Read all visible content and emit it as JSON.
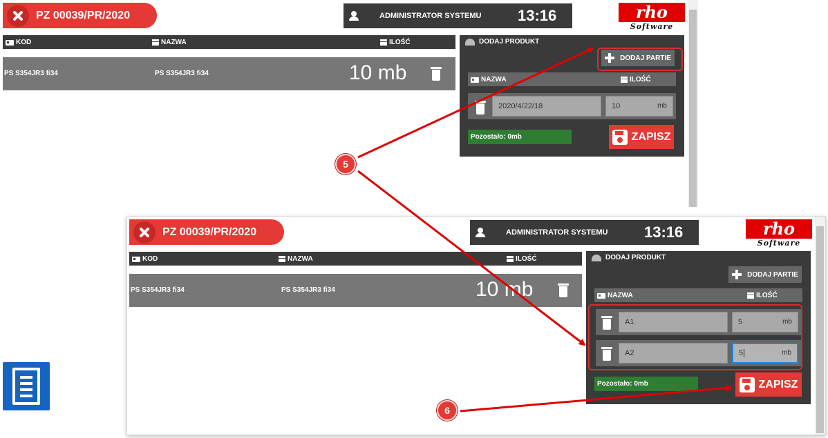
{
  "shots": [
    {
      "document_title": "PZ 00039/PR/2020",
      "user_name": "ADMINISTRATOR SYSTEMU",
      "clock": "13:16",
      "logo": {
        "main": "rho",
        "sub": "Software"
      },
      "table_headers": {
        "code": "KOD",
        "name": "NAZWA",
        "qty": "ILOŚĆ"
      },
      "product_row": {
        "code": "PS S354JR3 fi34",
        "name": "PS S354JR3 fi34",
        "qty": "10 mb"
      },
      "panel": {
        "title": "DODAJ PRODUKT",
        "add_batch_label": "DODAJ PARTIE",
        "sub_headers": {
          "name": "NAZWA",
          "qty": "ILOŚĆ"
        },
        "batches": [
          {
            "name": "2020/4/22/18",
            "qty": "10",
            "unit": "mb"
          }
        ],
        "remaining": "Pozostało: 0mb",
        "save_label": "ZAPISZ"
      }
    },
    {
      "document_title": "PZ 00039/PR/2020",
      "user_name": "ADMINISTRATOR SYSTEMU",
      "clock": "13:16",
      "logo": {
        "main": "rho",
        "sub": "Software"
      },
      "table_headers": {
        "code": "KOD",
        "name": "NAZWA",
        "qty": "ILOŚĆ"
      },
      "product_row": {
        "code": "PS S354JR3 fi34",
        "name": "PS S354JR3 fi34",
        "qty": "10 mb"
      },
      "panel": {
        "title": "DODAJ PRODUKT",
        "add_batch_label": "DODAJ PARTIE",
        "sub_headers": {
          "name": "NAZWA",
          "qty": "ILOŚĆ"
        },
        "batches": [
          {
            "name": "A1",
            "qty": "5",
            "unit": "mb"
          },
          {
            "name": "A2",
            "qty": "5",
            "unit": "mb"
          }
        ],
        "remaining": "Pozostało: 0mb",
        "save_label": "ZAPISZ"
      }
    }
  ],
  "callouts": [
    {
      "number": "5"
    },
    {
      "number": "6"
    }
  ],
  "icons": {
    "close": "x-circle-icon",
    "user": "user-icon",
    "card": "id-card-icon",
    "box": "archive-box-icon",
    "trash": "trash-icon",
    "warehouse": "warehouse-icon",
    "plus": "plus-icon",
    "save": "floppy-disk-icon",
    "receipt": "receipt-icon"
  },
  "colors": {
    "accent_red": "#e53935",
    "dark_bar": "#3a3a3a",
    "row_grey": "#777777",
    "remaining_green": "#2e7d32",
    "focus_blue": "#1e88e5",
    "receipt_blue": "#1565c0"
  }
}
